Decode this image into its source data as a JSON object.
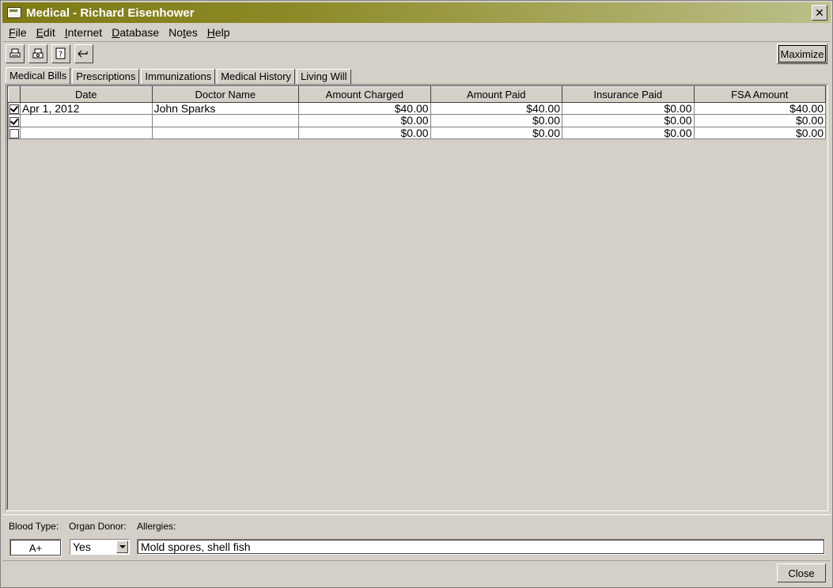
{
  "window": {
    "title": "Medical - Richard Eisenhower",
    "close_glyph": "✕"
  },
  "menu": [
    {
      "label_u": "F",
      "label_rest": "ile"
    },
    {
      "label_u": "E",
      "label_rest": "dit"
    },
    {
      "label_u": "I",
      "label_rest": "nternet"
    },
    {
      "label_u": "D",
      "label_rest": "atabase"
    },
    {
      "label_pre": "No",
      "label_u": "t",
      "label_rest": "es"
    },
    {
      "label_u": "H",
      "label_rest": "elp"
    }
  ],
  "toolbar": {
    "maximize_label": "Maximize"
  },
  "tabs": [
    "Medical Bills",
    "Prescriptions",
    "Immunizations",
    "Medical History",
    "Living Will"
  ],
  "grid": {
    "columns": [
      "Date",
      "Doctor Name",
      "Amount Charged",
      "Amount Paid",
      "Insurance Paid",
      "FSA Amount"
    ],
    "rows": [
      {
        "checked": true,
        "date": "Apr 1, 2012",
        "doctor": "John Sparks",
        "charged": "$40.00",
        "paid": "$40.00",
        "insurance": "$0.00",
        "fsa": "$40.00"
      },
      {
        "checked": true,
        "date": "",
        "doctor": "",
        "charged": "$0.00",
        "paid": "$0.00",
        "insurance": "$0.00",
        "fsa": "$0.00"
      },
      {
        "checked": false,
        "date": "",
        "doctor": "",
        "charged": "$0.00",
        "paid": "$0.00",
        "insurance": "$0.00",
        "fsa": "$0.00"
      }
    ]
  },
  "details": {
    "blood_type_label": "Blood Type:",
    "organ_donor_label": "Organ Donor:",
    "allergies_label": "Allergies:",
    "blood_type": "A+",
    "organ_donor": "Yes",
    "allergies": "Mold spores, shell fish"
  },
  "footer": {
    "close_label": "Close"
  }
}
